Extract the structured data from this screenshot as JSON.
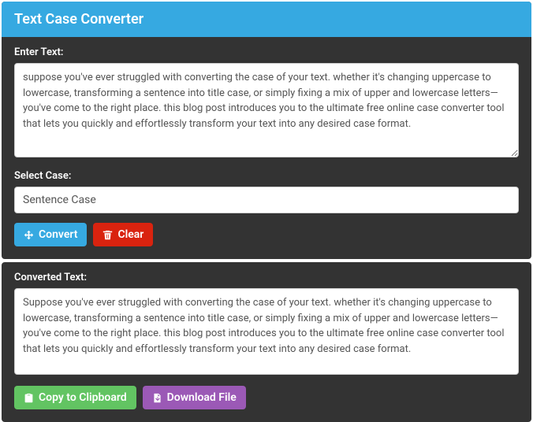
{
  "header": {
    "title": "Text Case Converter"
  },
  "input": {
    "label": "Enter Text:",
    "value": "suppose you've ever struggled with converting the case of your text. whether it's changing uppercase to lowercase, transforming a sentence into title case, or simply fixing a mix of upper and lowercase letters—you've come to the right place. this blog post introduces you to the ultimate free online case converter tool that lets you quickly and effortlessly transform your text into any desired case format."
  },
  "select": {
    "label": "Select Case:",
    "value": "Sentence Case"
  },
  "buttons": {
    "convert": "Convert",
    "clear": "Clear",
    "copy": "Copy to Clipboard",
    "download": "Download File"
  },
  "output": {
    "label": "Converted Text:",
    "value": "Suppose you've ever struggled with converting the case of your text. whether it's changing uppercase to lowercase, transforming a sentence into title case, or simply fixing a mix of upper and lowercase letters—you've come to the right place. this blog post introduces you to the ultimate free online case converter tool that lets you quickly and effortlessly transform your text into any desired case format."
  }
}
